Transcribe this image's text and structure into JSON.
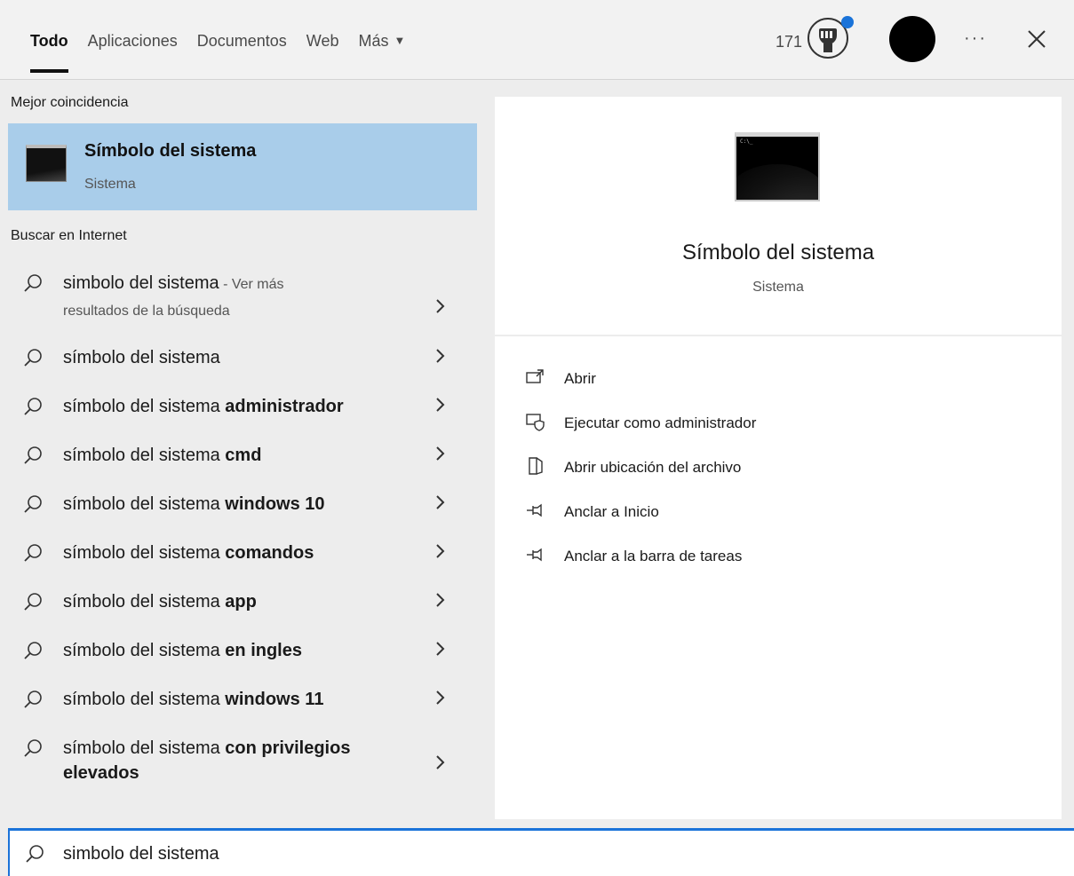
{
  "tabs": [
    {
      "label": "Todo",
      "active": true
    },
    {
      "label": "Aplicaciones",
      "active": false
    },
    {
      "label": "Documentos",
      "active": false
    },
    {
      "label": "Web",
      "active": false
    },
    {
      "label": "Más",
      "active": false
    }
  ],
  "topbar": {
    "points": "171",
    "more_icon": "more-icon",
    "close_icon": "close-icon"
  },
  "best_match": {
    "header": "Mejor coincidencia",
    "title": "Símbolo del sistema",
    "subtitle": "Sistema"
  },
  "web": {
    "header": "Buscar en Internet",
    "first": {
      "text": "simbolo del sistema",
      "suffix": " - Ver más",
      "line2": "resultados de la búsqueda"
    },
    "suggestions": [
      {
        "base": "símbolo del sistema",
        "bold": ""
      },
      {
        "base": "símbolo del sistema ",
        "bold": "administrador"
      },
      {
        "base": "símbolo del sistema ",
        "bold": "cmd"
      },
      {
        "base": "símbolo del sistema ",
        "bold": "windows 10"
      },
      {
        "base": "símbolo del sistema ",
        "bold": "comandos"
      },
      {
        "base": "símbolo del sistema ",
        "bold": "app"
      },
      {
        "base": "símbolo del sistema ",
        "bold": "en ingles"
      },
      {
        "base": "símbolo del sistema ",
        "bold": "windows 11"
      }
    ],
    "last": {
      "base": "símbolo del sistema ",
      "bold": "con privilegios",
      "bold2": "elevados"
    }
  },
  "preview": {
    "title": "Símbolo del sistema",
    "subtitle": "Sistema",
    "prompt": "C:\\_",
    "actions": [
      {
        "label": "Abrir",
        "icon": "open-icon"
      },
      {
        "label": "Ejecutar como administrador",
        "icon": "shield-icon"
      },
      {
        "label": "Abrir ubicación del archivo",
        "icon": "file-location-icon"
      },
      {
        "label": "Anclar a Inicio",
        "icon": "pin-icon"
      },
      {
        "label": "Anclar a la barra de tareas",
        "icon": "pin-icon"
      }
    ]
  },
  "search": {
    "value": "simbolo del sistema"
  },
  "colors": {
    "accent": "#1a73d9",
    "selected_bg": "#a9cdea",
    "background": "#ededed"
  }
}
